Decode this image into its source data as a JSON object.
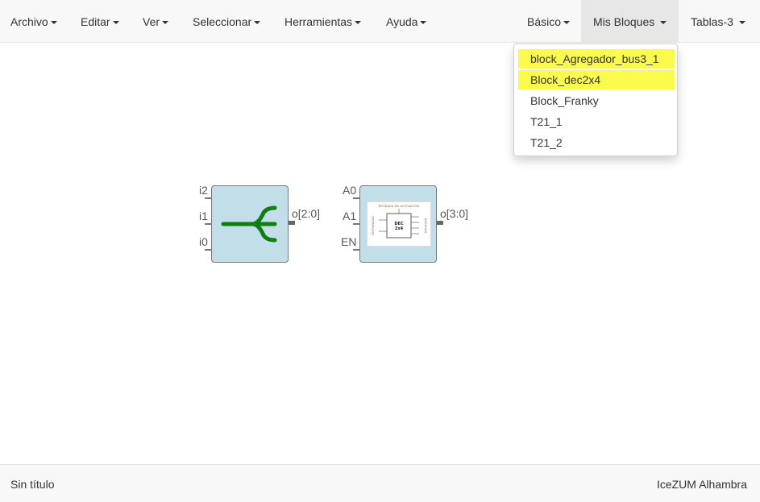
{
  "menubar": {
    "left": [
      {
        "label": "Archivo"
      },
      {
        "label": "Editar"
      },
      {
        "label": "Ver"
      },
      {
        "label": "Seleccionar"
      },
      {
        "label": "Herramientas"
      },
      {
        "label": "Ayuda"
      }
    ],
    "right": [
      {
        "label": "Básico"
      },
      {
        "label": "Mis Bloques"
      },
      {
        "label": "Tablas-3"
      }
    ]
  },
  "dropdown": {
    "items": [
      {
        "label": "block_Agregador_bus3_1",
        "highlighted": true
      },
      {
        "label": "Block_dec2x4",
        "highlighted": true
      },
      {
        "label": "Block_Franky",
        "highlighted": false
      },
      {
        "label": "T21_1",
        "highlighted": false
      },
      {
        "label": "T21_2",
        "highlighted": false
      }
    ]
  },
  "canvas": {
    "block_bus": {
      "inputs": [
        "i2",
        "i1",
        "i0"
      ],
      "output": "o[2:0]",
      "icon": "bus-join-icon",
      "icon_color": "#0f7d0f"
    },
    "block_dec": {
      "inputs": [
        "A0",
        "A1",
        "EN"
      ],
      "output": "o[3:0]",
      "icon": "decoder-2x4-image",
      "image_text": {
        "top": "ENTRADA DE ACTIVACIÓN",
        "left": "ENTRADAS",
        "right": "SALIDAS",
        "center_line1": "DEC",
        "center_line2": "2x4"
      }
    }
  },
  "statusbar": {
    "title": "Sin título",
    "app": "IceZUM Alhambra"
  },
  "colors": {
    "menubar_bg": "#f8f8f8",
    "block_fill": "#c2dfe9",
    "highlight": "#fbfb4e"
  }
}
